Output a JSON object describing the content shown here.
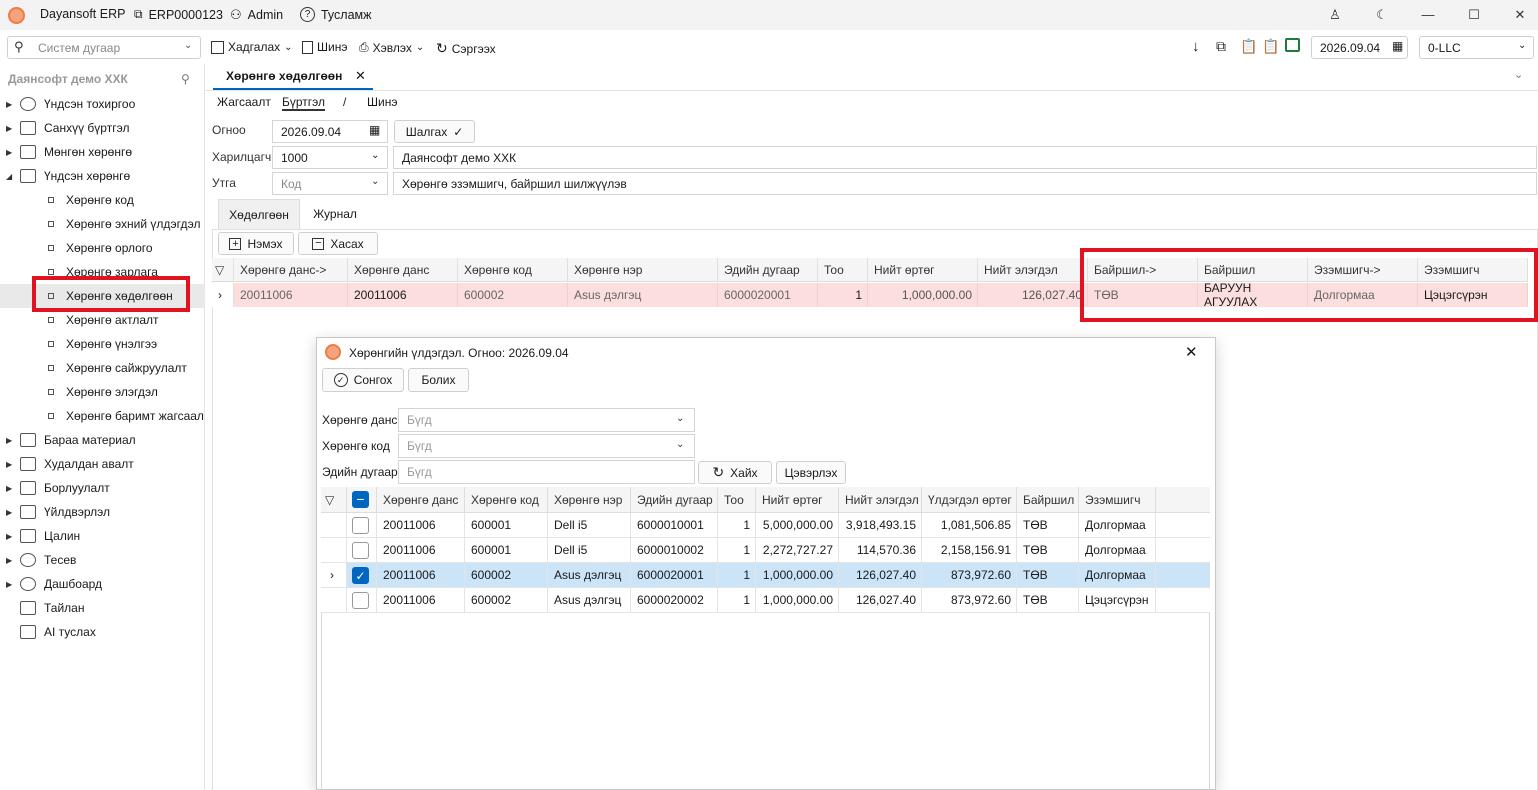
{
  "titlebar": {
    "app": "Dayansoft ERP",
    "db": "ERP0000123",
    "user": "Admin",
    "help": "Тусламж"
  },
  "toolbar": {
    "search_placeholder": "Систем дугаар",
    "save": "Хадгалах",
    "new": "Шинэ",
    "print": "Хэвлэх",
    "refresh": "Сэргээх",
    "date": "2026.09.04",
    "company": "0-LLC"
  },
  "sidebar": {
    "title": "Даянсофт демо ХХК",
    "items": [
      {
        "label": "Үндсэн тохиргоо"
      },
      {
        "label": "Санхүү бүртгэл"
      },
      {
        "label": "Мөнгөн хөрөнгө"
      },
      {
        "label": "Үндсэн хөрөнгө"
      }
    ],
    "children": [
      {
        "label": "Хөрөнгө код"
      },
      {
        "label": "Хөрөнгө эхний үлдэгдэл"
      },
      {
        "label": "Хөрөнгө орлого"
      },
      {
        "label": "Хөрөнгө зарлага"
      },
      {
        "label": "Хөрөнгө хөдөлгөөн"
      },
      {
        "label": "Хөрөнгө актлалт"
      },
      {
        "label": "Хөрөнгө үнэлгээ"
      },
      {
        "label": "Хөрөнгө сайжруулалт"
      },
      {
        "label": "Хөрөнгө элэгдэл"
      },
      {
        "label": "Хөрөнгө баримт жагсаал"
      }
    ],
    "items2": [
      {
        "label": "Бараа материал"
      },
      {
        "label": "Худалдан авалт"
      },
      {
        "label": "Борлуулалт"
      },
      {
        "label": "Үйлдвэрлэл"
      },
      {
        "label": "Цалин"
      },
      {
        "label": "Тесев"
      },
      {
        "label": "Дашбоард"
      },
      {
        "label": "Тайлан"
      },
      {
        "label": "AI туслах"
      }
    ]
  },
  "main": {
    "tab": "Хөрөнгө хөдөлгөөн",
    "breadcrumb": {
      "a": "Жагсаалт",
      "b": "Бүртгэл",
      "sep": "/",
      "c": "Шинэ"
    },
    "form": {
      "date_label": "Огноо",
      "date": "2026.09.04",
      "check": "Шалгах",
      "partner_label": "Харилцагч",
      "partner_code": "1000",
      "partner_name": "Даянсофт демо ХХК",
      "desc_label": "Утга",
      "desc_placeholder": "Код",
      "desc": "Хөрөнгө эзэмшигч, байршил шилжүүлэв"
    },
    "subtabs": [
      "Хөдөлгөөн",
      "Журнал"
    ],
    "add": "Нэмэх",
    "remove": "Хасах",
    "grid_headers": [
      "Хөрөнгө данс->",
      "Хөрөнгө данс",
      "Хөрөнгө код",
      "Хөрөнгө нэр",
      "Эдийн дугаар",
      "Тоо",
      "Нийт өртөг",
      "Нийт элэгдэл",
      "Байршил->",
      "Байршил",
      "Эзэмшигч->",
      "Эзэмшигч"
    ],
    "grid_row": [
      "20011006",
      "20011006",
      "600002",
      "Asus дэлгэц",
      "6000020001",
      "1",
      "1,000,000.00",
      "126,027.40",
      "ТӨВ",
      "БАРУУН АГУУЛАХ",
      "Долгормаа",
      "Цэцэгсүрэн"
    ]
  },
  "dialog": {
    "title": "Хөрөнгийн үлдэгдэл. Огноо: 2026.09.04",
    "choose": "Сонгох",
    "cancel": "Болих",
    "f1_label": "Хөрөнгө данс",
    "f2_label": "Хөрөнгө код",
    "f3_label": "Эдийн дугаар",
    "all": "Бүгд",
    "search": "Хайх",
    "clear": "Цэвэрлэх",
    "headers": [
      "Хөрөнгө данс",
      "Хөрөнгө код",
      "Хөрөнгө нэр",
      "Эдийн дугаар",
      "Тоо",
      "Нийт өртөг",
      "Нийт элэгдэл",
      "Үлдэгдэл өртөг",
      "Байршил",
      "Эзэмшигч"
    ],
    "rows": [
      [
        "20011006",
        "600001",
        "Dell i5",
        "6000010001",
        "1",
        "5,000,000.00",
        "3,918,493.15",
        "1,081,506.85",
        "ТӨВ",
        "Долгормаа"
      ],
      [
        "20011006",
        "600001",
        "Dell i5",
        "6000010002",
        "1",
        "2,272,727.27",
        "114,570.36",
        "2,158,156.91",
        "ТӨВ",
        "Долгормаа"
      ],
      [
        "20011006",
        "600002",
        "Asus дэлгэц",
        "6000020001",
        "1",
        "1,000,000.00",
        "126,027.40",
        "873,972.60",
        "ТӨВ",
        "Долгормаа"
      ],
      [
        "20011006",
        "600002",
        "Asus дэлгэц",
        "6000020002",
        "1",
        "1,000,000.00",
        "126,027.40",
        "873,972.60",
        "ТӨВ",
        "Цэцэгсүрэн"
      ]
    ]
  }
}
